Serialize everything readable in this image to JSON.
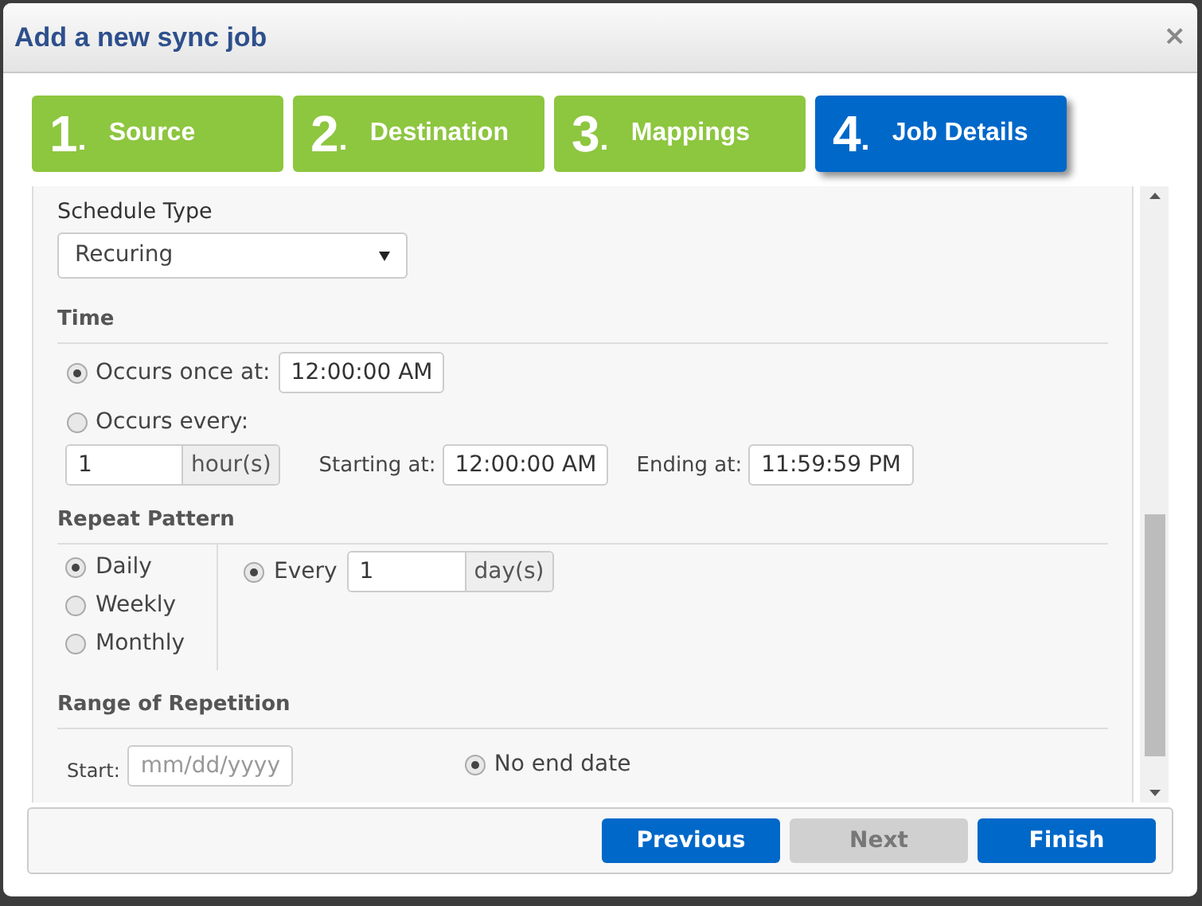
{
  "window": {
    "title": "Add a new sync job",
    "close": "×"
  },
  "steps": [
    {
      "number": "1",
      "dot": ".",
      "label": "Source",
      "selected": false
    },
    {
      "number": "2",
      "dot": ".",
      "label": "Destination",
      "selected": false
    },
    {
      "number": "3",
      "dot": ".",
      "label": "Mappings",
      "selected": false
    },
    {
      "number": "4",
      "dot": ".",
      "label": "Job Details",
      "selected": true
    }
  ],
  "schedule_type": {
    "label": "Schedule Type",
    "value": "Recuring"
  },
  "time": {
    "heading": "Time",
    "once": {
      "label": "Occurs once at:",
      "selected": true,
      "value": "12:00:00 AM"
    },
    "every": {
      "label": "Occurs every:",
      "selected": false,
      "value": "1",
      "unit": "hour(s)",
      "start_label": "Starting at:",
      "start_value": "12:00:00 AM",
      "end_label": "Ending at:",
      "end_value": "11:59:59 PM"
    }
  },
  "repeat_pattern": {
    "heading": "Repeat Pattern",
    "options": [
      {
        "label": "Daily",
        "selected": true
      },
      {
        "label": "Weekly",
        "selected": false
      },
      {
        "label": "Monthly",
        "selected": false
      }
    ],
    "every": {
      "label": "Every",
      "selected": true,
      "value": "1",
      "unit": "day(s)"
    }
  },
  "range": {
    "heading": "Range of Repetition",
    "start_label": "Start:",
    "start_placeholder": "mm/dd/yyyy",
    "end_options": [
      {
        "label": "No end date",
        "selected": true
      }
    ]
  },
  "buttons": [
    {
      "label": "Previous",
      "disabled": false
    },
    {
      "label": "Next",
      "disabled": true
    },
    {
      "label": "Finish",
      "disabled": false
    }
  ]
}
